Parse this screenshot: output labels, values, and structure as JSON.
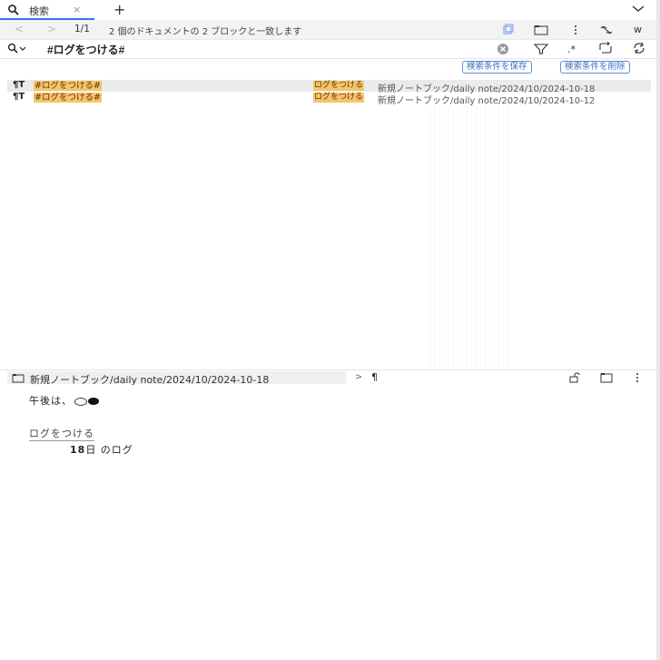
{
  "tabbar": {
    "tab_label": "検索",
    "tab_close": "×",
    "new_tab": "+"
  },
  "toolbar": {
    "page": "1/1",
    "match_summary": "2 個のドキュメントの 2 ブロックと一致します",
    "right_text": "w"
  },
  "search": {
    "query": "#ログをつける#"
  },
  "actions": {
    "save_label": "検索条件を保存",
    "delete_label": "検索条件を削除"
  },
  "results": [
    {
      "text": "#ログをつける#",
      "tag": "ログをつける",
      "path": "新規ノートブック/daily note/2024/10/2024-10-18"
    },
    {
      "text": "#ログをつける#",
      "tag": "ログをつける",
      "path": "新規ノートブック/daily note/2024/10/2024-10-12"
    }
  ],
  "preview": {
    "breadcrumb": "新規ノートブック/daily note/2024/10/2024-10-18",
    "separator": ">",
    "line1": "午後は、",
    "link": "ログをつける",
    "line3_num": "18",
    "line3_rest": "日 のログ"
  },
  "colors": {
    "accent": "#3574f0",
    "highlight": "#f7c46b",
    "selected_row": "#ebebeb"
  }
}
